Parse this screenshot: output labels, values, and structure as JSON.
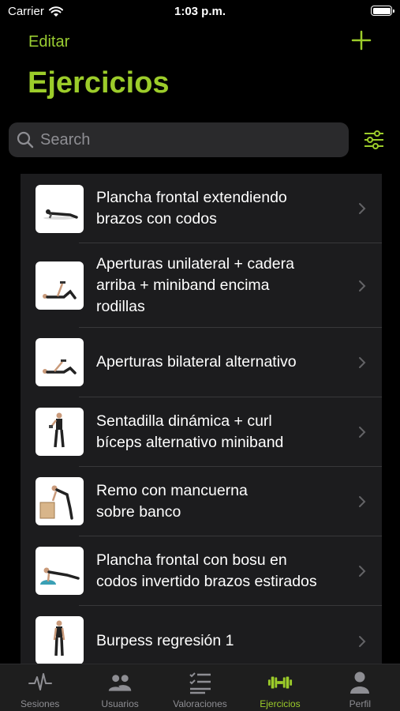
{
  "status": {
    "carrier": "Carrier",
    "time": "1:03 p.m."
  },
  "nav": {
    "edit_label": "Editar",
    "title": "Ejercicios"
  },
  "search": {
    "placeholder": "Search"
  },
  "exercises": [
    {
      "label": "Plancha frontal extendiendo\nbrazos con codos",
      "icon": "plank-figure"
    },
    {
      "label": "Aperturas unilateral + cadera\narriba + miniband encima\nrodillas",
      "icon": "lying-figure"
    },
    {
      "label": "Aperturas bilateral alternativo",
      "icon": "lying-figure"
    },
    {
      "label": "Sentadilla dinámica + curl\nbíceps alternativo miniband",
      "icon": "standing-figure"
    },
    {
      "label": "Remo con mancuerna\nsobre banco",
      "icon": "row-figure"
    },
    {
      "label": "Plancha frontal con bosu en\ncodos invertido brazos estirados",
      "icon": "bosu-plank-figure"
    },
    {
      "label": "Burpess regresión 1",
      "icon": "standing-figure"
    }
  ],
  "tabs": [
    {
      "label": "Sesiones",
      "icon": "pulse-icon",
      "active": false
    },
    {
      "label": "Usuarios",
      "icon": "users-icon",
      "active": false
    },
    {
      "label": "Valoraciones",
      "icon": "checklist-icon",
      "active": false
    },
    {
      "label": "Ejercicios",
      "icon": "dumbbell-icon",
      "active": true
    },
    {
      "label": "Perfil",
      "icon": "person-icon",
      "active": false
    }
  ],
  "colors": {
    "accent": "#9ccc2a",
    "background": "#000000",
    "card": "#1c1c1e",
    "inactive": "#8e8e93"
  }
}
